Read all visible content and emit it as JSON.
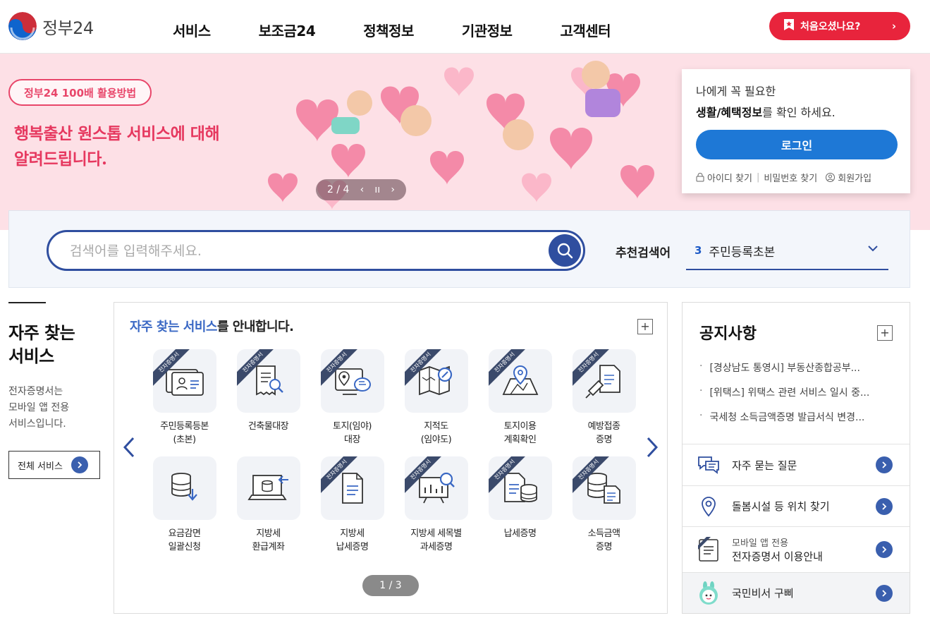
{
  "header": {
    "logo_text": "정부24",
    "nav": [
      "서비스",
      "보조금24",
      "정책정보",
      "기관정보",
      "고객센터"
    ],
    "first_visit_label": "처음오셨나요?"
  },
  "banner": {
    "tag": "정부24 100배 활용방법",
    "copy_line1": "행복출산 원스톱 서비스에 대해",
    "copy_line2": "알려드립니다.",
    "slide_counter": "2 / 4",
    "colors": {
      "bg": "#fde0e6",
      "accent": "#e8466a"
    }
  },
  "login": {
    "line1": "나에게 꼭 필요한",
    "line2_bold": "생활/혜택정보",
    "line2_rest": "를 확인 하세요.",
    "button": "로그인",
    "find_id": "아이디 찾기",
    "find_pw": "비밀번호 찾기",
    "join": "회원가입"
  },
  "search": {
    "placeholder": "검색어를 입력해주세요.",
    "rec_label": "추천검색어",
    "rec_num": "3",
    "rec_text": "주민등록초본"
  },
  "frequent": {
    "title_line1": "자주 찾는",
    "title_line2": "서비스",
    "desc": "전자증명서는\n모바일 앱 전용\n서비스입니다.",
    "all_button": "전체 서비스"
  },
  "services": {
    "title_highlight": "자주 찾는 서비스",
    "title_rest": "를 안내합니다.",
    "ribbon_text": "전자증명서",
    "pager": "1 / 3",
    "items": [
      {
        "label": "주민등록등본\n(초본)",
        "icon": "id-card-icon",
        "ribbon": true
      },
      {
        "label": "건축물대장",
        "icon": "document-search-icon",
        "ribbon": true
      },
      {
        "label": "토지(임야)\n대장",
        "icon": "map-pin-chat-icon",
        "ribbon": true
      },
      {
        "label": "지적도\n(임야도)",
        "icon": "map-search-icon",
        "ribbon": true
      },
      {
        "label": "토지이용\n계획확인",
        "icon": "folded-map-icon",
        "ribbon": true
      },
      {
        "label": "예방접종\n증명",
        "icon": "syringe-icon",
        "ribbon": true
      },
      {
        "label": "요금감면\n일괄신청",
        "icon": "database-download-icon",
        "ribbon": false
      },
      {
        "label": "지방세\n환급계좌",
        "icon": "laptop-transfer-icon",
        "ribbon": false
      },
      {
        "label": "지방세\n납세증명",
        "icon": "document-icon",
        "ribbon": true
      },
      {
        "label": "지방세 세목별\n과세증명",
        "icon": "chart-board-icon",
        "ribbon": true
      },
      {
        "label": "납세증명",
        "icon": "document-coins-icon",
        "ribbon": true
      },
      {
        "label": "소득금액\n증명",
        "icon": "coins-document-icon",
        "ribbon": true
      }
    ]
  },
  "notice": {
    "title": "공지사항",
    "items": [
      "[경상남도 통영시] 부동산종합공부...",
      "[위택스] 위택스 관련 서비스 일시 중...",
      "국세청 소득금액증명 발급서식 변경..."
    ],
    "quick": [
      {
        "label": "자주 묻는 질문",
        "icon": "faq-chat-icon"
      },
      {
        "label": "돌봄시설 등 위치 찾기",
        "icon": "location-pin-icon"
      },
      {
        "small": "모바일 앱 전용",
        "label": "전자증명서 이용안내",
        "icon": "e-certificate-icon"
      },
      {
        "label": "국민비서 구삐",
        "icon": "gubbi-mascot-icon"
      }
    ]
  }
}
